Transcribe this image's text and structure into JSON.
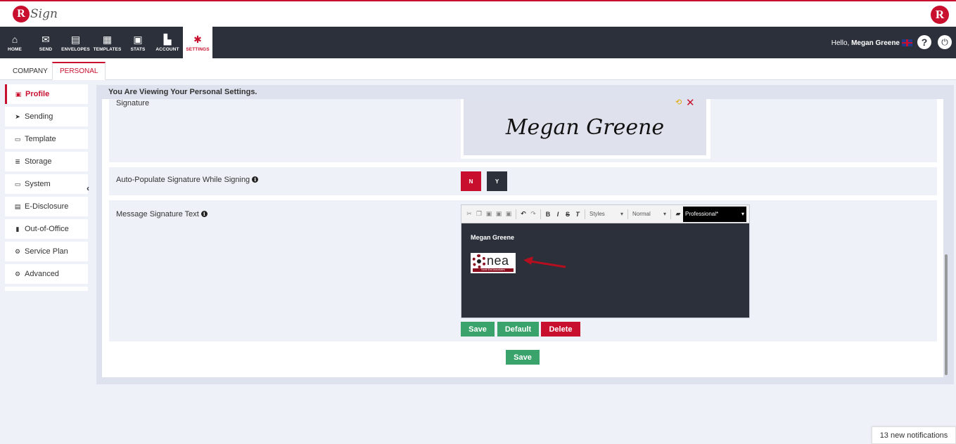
{
  "app": {
    "brand_letter": "R",
    "brand_text": "Sign"
  },
  "nav": {
    "items": [
      {
        "label": "HOME",
        "icon": "home-icon",
        "glyph": "⌂"
      },
      {
        "label": "SEND",
        "icon": "envelope-icon",
        "glyph": "✉"
      },
      {
        "label": "ENVELOPES",
        "icon": "inbox-icon",
        "glyph": "▤"
      },
      {
        "label": "TEMPLATES",
        "icon": "document-icon",
        "glyph": "▦"
      },
      {
        "label": "STATS",
        "icon": "briefcase-icon",
        "glyph": "▣"
      },
      {
        "label": "ACCOUNT",
        "icon": "account-icon",
        "glyph": "▙"
      },
      {
        "label": "SETTINGS",
        "icon": "gear-icon",
        "glyph": "✱"
      }
    ],
    "hello_prefix": "Hello,",
    "user_name": "Megan Greene",
    "help_glyph": "?",
    "power_glyph": "⏻"
  },
  "tabs": {
    "company": "COMPANY",
    "personal": "PERSONAL"
  },
  "sidebar": {
    "items": [
      {
        "label": "Profile",
        "glyph": "▣"
      },
      {
        "label": "Sending",
        "glyph": "➤"
      },
      {
        "label": "Template",
        "glyph": "▭"
      },
      {
        "label": "Storage",
        "glyph": "≣"
      },
      {
        "label": "System",
        "glyph": "▭"
      },
      {
        "label": "E-Disclosure",
        "glyph": "▤"
      },
      {
        "label": "Out-of-Office",
        "glyph": "▮"
      },
      {
        "label": "Service Plan",
        "glyph": "⚙"
      },
      {
        "label": "Advanced",
        "glyph": "⚙"
      }
    ],
    "collapse_glyph": "‹"
  },
  "content": {
    "heading": "You Are Viewing Your Personal Settings.",
    "signature_label": "Signature",
    "signature_text": "Megan Greene",
    "auto_populate_label": "Auto-Populate Signature While Signing",
    "no_label": "N",
    "yes_label": "Y",
    "message_signature_label": "Message Signature Text",
    "info_glyph": "i"
  },
  "editor": {
    "styles_label": "Styles",
    "format_label": "Normal",
    "theme_label": "Professional*",
    "body_name": "Megan Greene",
    "logo_text": "nea",
    "logo_subtext": "North End Associates"
  },
  "buttons": {
    "save": "Save",
    "default": "Default",
    "delete": "Delete",
    "save_main": "Save"
  },
  "notifications": {
    "text": "13 new notifications"
  },
  "colors": {
    "brand_red": "#c8102e",
    "nav_dark": "#2b303b",
    "green": "#3aa36b"
  }
}
